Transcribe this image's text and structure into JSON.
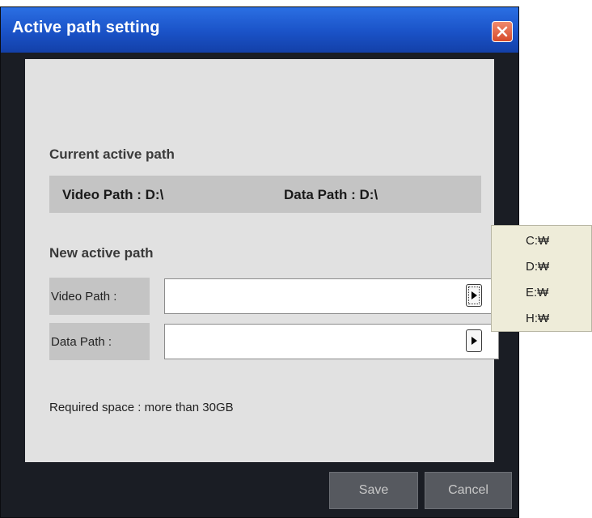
{
  "window": {
    "title": "Active path setting"
  },
  "current": {
    "heading": "Current active path",
    "video_path": "Video Path : D:\\",
    "data_path": "Data Path : D:\\"
  },
  "new_path": {
    "heading": "New active path",
    "video_label": "Video Path :",
    "data_label": "Data Path :",
    "video_value": "",
    "data_value": ""
  },
  "required_space": "Required space : more than 30GB",
  "buttons": {
    "save": "Save",
    "cancel": "Cancel"
  },
  "drive_menu": [
    "C:₩",
    "D:₩",
    "E:₩",
    "H:₩"
  ],
  "icons": {
    "close": "close-x-icon",
    "browse": "play-arrow-icon"
  }
}
